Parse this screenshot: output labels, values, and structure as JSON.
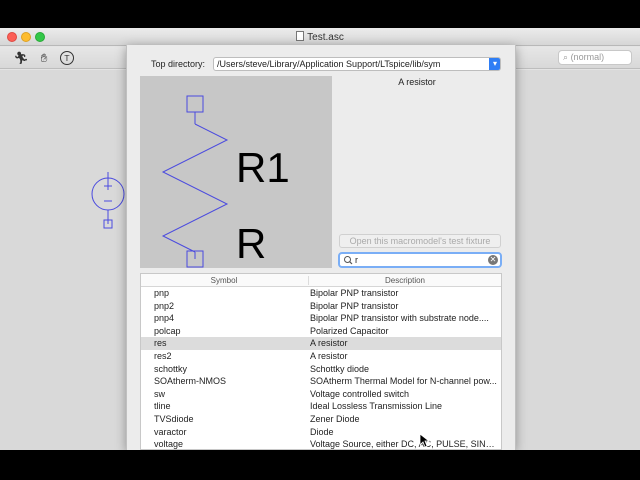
{
  "window": {
    "title": "Test.asc"
  },
  "toolbar": {
    "search_placeholder": "(normal)"
  },
  "dialog": {
    "top_directory_label": "Top directory:",
    "top_directory_value": "/Users/steve/Library/Application Support/LTspice/lib/sym",
    "preview": {
      "ref_label": "R1",
      "value_label": "R"
    },
    "symbol_description": "A resistor",
    "test_fixture_button": "Open this macromodel's test fixture",
    "filter_value": "r",
    "table": {
      "columns": [
        "Symbol",
        "Description"
      ],
      "rows": [
        {
          "symbol": "pnp",
          "description": "Bipolar PNP transistor"
        },
        {
          "symbol": "pnp2",
          "description": "Bipolar PNP transistor"
        },
        {
          "symbol": "pnp4",
          "description": "Bipolar PNP transistor with substrate node...."
        },
        {
          "symbol": "polcap",
          "description": "Polarized Capacitor"
        },
        {
          "symbol": "res",
          "description": "A resistor",
          "selected": true
        },
        {
          "symbol": "res2",
          "description": "A resistor"
        },
        {
          "symbol": "schottky",
          "description": "Schottky diode"
        },
        {
          "symbol": "SOAtherm-NMOS",
          "description": "SOAtherm Thermal Model for N-channel pow..."
        },
        {
          "symbol": "sw",
          "description": "Voltage controlled switch"
        },
        {
          "symbol": "tline",
          "description": "Ideal Lossless Transmission Line"
        },
        {
          "symbol": "TVSdiode",
          "description": "Zener Diode"
        },
        {
          "symbol": "varactor",
          "description": "Diode"
        },
        {
          "symbol": "voltage",
          "description": "Voltage Source, either DC, AC, PULSE, SINE,..."
        }
      ]
    }
  },
  "colors": {
    "symbol_stroke": "#4a4adf",
    "accent": "#2f7ef5",
    "selected_row": "#dcdcdc"
  }
}
